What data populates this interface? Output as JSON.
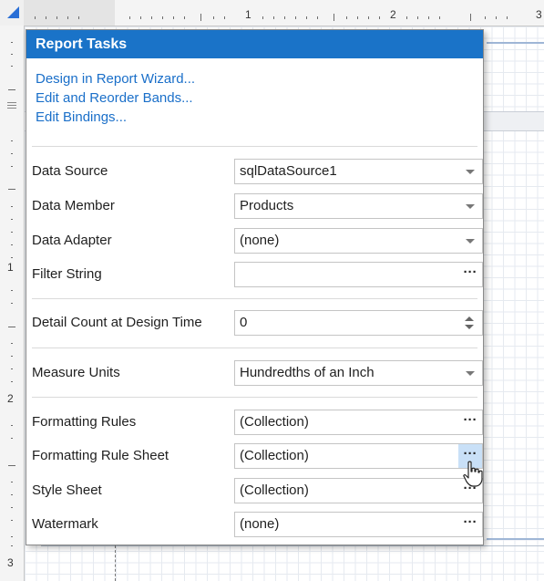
{
  "ruler": {
    "h_numbers": [
      "1",
      "2",
      "3"
    ],
    "v_numbers": [
      "1",
      "2",
      "3"
    ]
  },
  "panel": {
    "title": "Report Tasks",
    "links": [
      "Design in Report Wizard...",
      "Edit and Reorder Bands...",
      "Edit Bindings..."
    ],
    "data_source": {
      "label": "Data Source",
      "value": "sqlDataSource1"
    },
    "data_member": {
      "label": "Data Member",
      "value": "Products"
    },
    "data_adapter": {
      "label": "Data Adapter",
      "value": "(none)"
    },
    "filter_string": {
      "label": "Filter String",
      "value": ""
    },
    "detail_count": {
      "label": "Detail Count at Design Time",
      "value": "0"
    },
    "measure_units": {
      "label": "Measure Units",
      "value": "Hundredths of an Inch"
    },
    "formatting_rules": {
      "label": "Formatting Rules",
      "value": "(Collection)"
    },
    "formatting_rule_sheet": {
      "label": "Formatting Rule Sheet",
      "value": "(Collection)"
    },
    "style_sheet": {
      "label": "Style Sheet",
      "value": "(Collection)"
    },
    "watermark": {
      "label": "Watermark",
      "value": "(none)"
    },
    "ellipsis_label": "···"
  },
  "colors": {
    "header": "#1a73c8",
    "link": "#1a6fc9",
    "hover_button": "#c9e0f7"
  }
}
